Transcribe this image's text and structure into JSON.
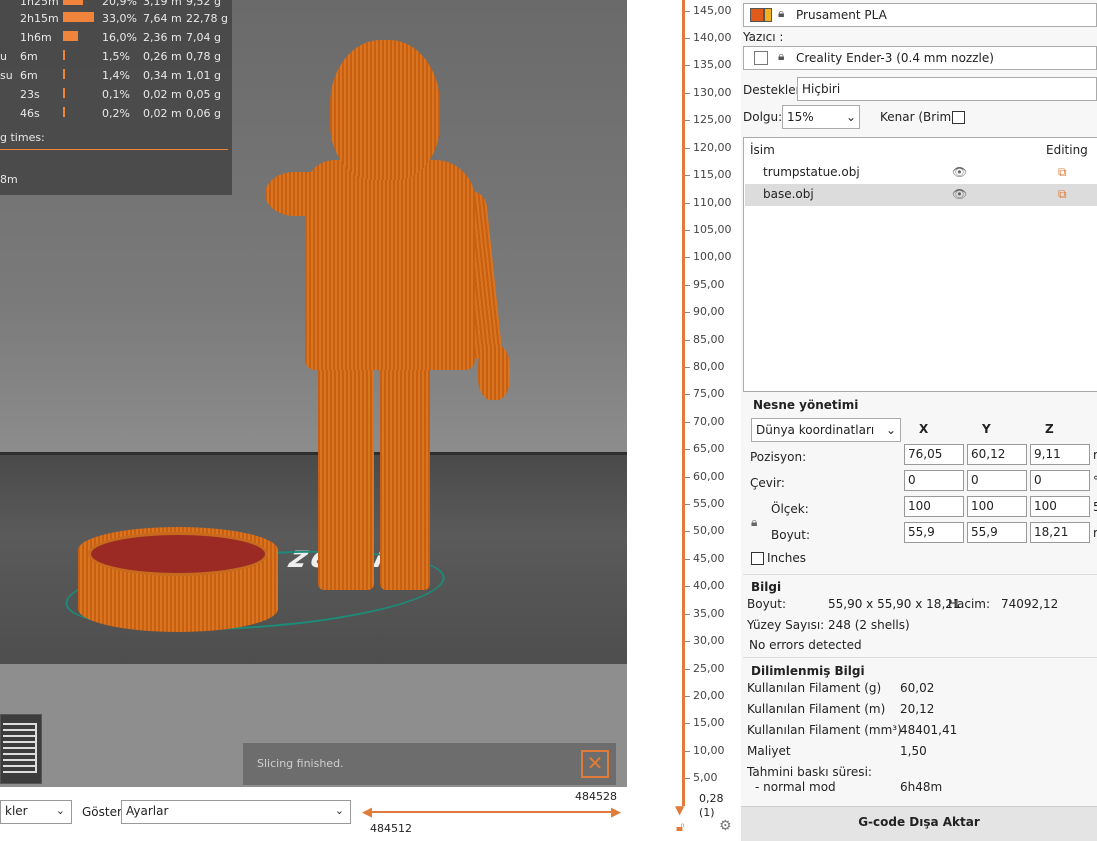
{
  "stats": {
    "rows": [
      {
        "label": "",
        "time": "1h25m",
        "pct": "20,9%",
        "m": "3,19 m",
        "g": "9,52 g",
        "bar": 0.209
      },
      {
        "label": "",
        "time": "2h15m",
        "pct": "33,0%",
        "m": "7,64 m",
        "g": "22,78 g",
        "bar": 0.33
      },
      {
        "label": "",
        "time": "1h6m",
        "pct": "16,0%",
        "m": "2,36 m",
        "g": "7,04 g",
        "bar": 0.16
      },
      {
        "label": "u",
        "time": "6m",
        "pct": "1,5%",
        "m": "0,26 m",
        "g": "0,78 g",
        "bar": 0.015
      },
      {
        "label": "su",
        "time": "6m",
        "pct": "1,4%",
        "m": "0,34 m",
        "g": "1,01 g",
        "bar": 0.014
      },
      {
        "label": "",
        "time": "23s",
        "pct": "0,1%",
        "m": "0,02 m",
        "g": "0,05 g",
        "bar": 0.001
      },
      {
        "label": "",
        "time": "46s",
        "pct": "0,2%",
        "m": "0,02 m",
        "g": "0,06 g",
        "bar": 0.002
      }
    ],
    "times_label": "g times:",
    "total_label": "8m"
  },
  "viewport": {
    "bed_logo": "zeler",
    "notification": "Slicing finished.",
    "close_glyph": "✕"
  },
  "bottom": {
    "left_combo": "kler",
    "goster_label": "Göster",
    "goster_value": "Ayarlar",
    "slider_top_value": "484528",
    "slider_bottom_value": "484512"
  },
  "vslider": {
    "ticks": [
      "145,00",
      "140,00",
      "135,00",
      "130,00",
      "125,00",
      "120,00",
      "115,00",
      "110,00",
      "105,00",
      "100,00",
      "95,00",
      "90,00",
      "85,00",
      "80,00",
      "75,00",
      "70,00",
      "65,00",
      "60,00",
      "55,00",
      "50,00",
      "45,00",
      "40,00",
      "35,00",
      "30,00",
      "25,00",
      "20,00",
      "15,00",
      "10,00",
      "5,00"
    ],
    "bottom_value": "0,28",
    "bottom_index": "(1)"
  },
  "sidebar": {
    "filament": "Prusament PLA",
    "printer_label": "Yazıcı :",
    "printer": "Creality Ender-3 (0.4 mm nozzle)",
    "supports_label": "Destekler:",
    "supports_value": "Hiçbiri",
    "infill_label": "Dolgu:",
    "infill_value": "15%",
    "brim_label": "Kenar (Brim):",
    "list_headers": {
      "name": "İsim",
      "editing": "Editing"
    },
    "objects": [
      {
        "name": "trumpstatue.obj"
      },
      {
        "name": "base.obj"
      }
    ],
    "manip": {
      "title": "Nesne yönetimi",
      "coords": "Dünya koordinatları",
      "x": "X",
      "y": "Y",
      "z": "Z",
      "position_label": "Pozisyon:",
      "position": [
        "76,05",
        "60,12",
        "9,11"
      ],
      "rotate_label": "Çevir:",
      "rotate": [
        "0",
        "0",
        "0"
      ],
      "scale_label": "Ölçek:",
      "scale": [
        "100",
        "100",
        "100"
      ],
      "size_label": "Boyut:",
      "size": [
        "55,9",
        "55,9",
        "18,21"
      ],
      "inches": "Inches",
      "unit_pos": "r",
      "unit_rot": "°",
      "unit_scale": "5",
      "unit_size": "r"
    },
    "info": {
      "title": "Bilgi",
      "size_label": "Boyut:",
      "size": "55,90 x 55,90 x 18,21",
      "volume_label": "Hacim:",
      "volume": "74092,12",
      "facets_label": "Yüzey Sayısı:",
      "facets": "248 (2 shells)",
      "errors": "No errors detected"
    },
    "sliced": {
      "title": "Dilimlenmiş Bilgi",
      "rows": [
        {
          "label": "Kullanılan Filament (g)",
          "value": "60,02"
        },
        {
          "label": "Kullanılan Filament (m)",
          "value": "20,12"
        },
        {
          "label": "Kullanılan Filament (mm³)",
          "value": "48401,41"
        },
        {
          "label": "Maliyet",
          "value": "1,50"
        }
      ],
      "time_label": "Tahmini baskı süresi:",
      "mode_label": "- normal mod",
      "mode_value": "6h48m"
    },
    "export": "G-code Dışa Aktar"
  }
}
